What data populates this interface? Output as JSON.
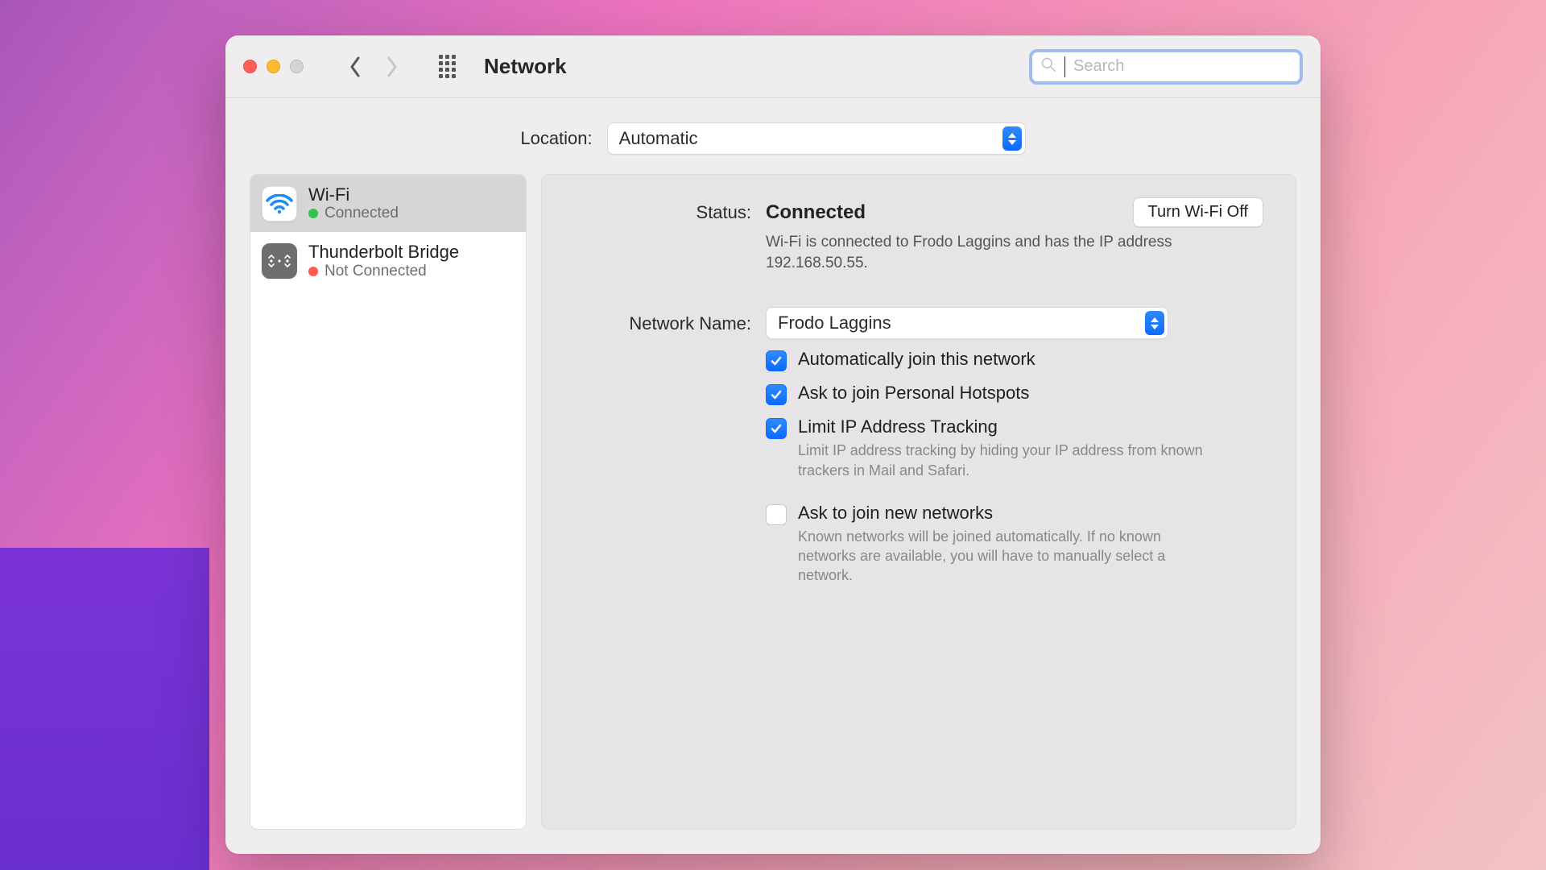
{
  "window": {
    "title": "Network"
  },
  "search": {
    "placeholder": "Search"
  },
  "location": {
    "label": "Location:",
    "value": "Automatic"
  },
  "sidebar": {
    "items": [
      {
        "name": "Wi-Fi",
        "status": "Connected",
        "status_color": "green",
        "selected": true
      },
      {
        "name": "Thunderbolt Bridge",
        "status": "Not Connected",
        "status_color": "red",
        "selected": false
      }
    ]
  },
  "detail": {
    "status_label": "Status:",
    "status_value": "Connected",
    "toggle_button": "Turn Wi-Fi Off",
    "status_desc": "Wi-Fi is connected to Frodo Laggins and has the IP address 192.168.50.55.",
    "network_name_label": "Network Name:",
    "network_name_value": "Frodo Laggins",
    "options": [
      {
        "label": "Automatically join this network",
        "checked": true
      },
      {
        "label": "Ask to join Personal Hotspots",
        "checked": true
      },
      {
        "label": "Limit IP Address Tracking",
        "checked": true,
        "help": "Limit IP address tracking by hiding your IP address from known trackers in Mail and Safari."
      },
      {
        "label": "Ask to join new networks",
        "checked": false,
        "help": "Known networks will be joined automatically. If no known networks are available, you will have to manually select a network."
      }
    ]
  }
}
